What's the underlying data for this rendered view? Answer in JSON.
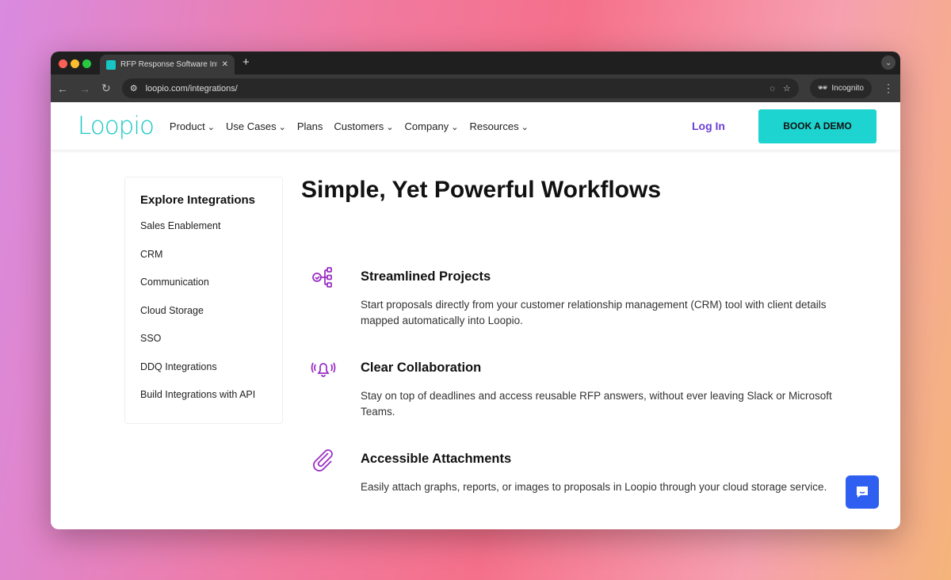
{
  "browser": {
    "tab_title": "RFP Response Software Integ",
    "url": "loopio.com/integrations/",
    "incognito": "Incognito"
  },
  "nav": {
    "logo": "Loopio",
    "items": [
      {
        "label": "Product",
        "dropdown": true
      },
      {
        "label": "Use Cases",
        "dropdown": true
      },
      {
        "label": "Plans",
        "dropdown": false
      },
      {
        "label": "Customers",
        "dropdown": true
      },
      {
        "label": "Company",
        "dropdown": true
      },
      {
        "label": "Resources",
        "dropdown": true
      }
    ],
    "login": "Log In",
    "demo": "BOOK A DEMO"
  },
  "sidebar": {
    "title": "Explore Integrations",
    "items": [
      "Sales Enablement",
      "CRM",
      "Communication",
      "Cloud Storage",
      "SSO",
      "DDQ Integrations",
      "Build Integrations with API"
    ]
  },
  "main": {
    "title": "Simple, Yet Powerful Workflows",
    "features": [
      {
        "icon": "workflow-icon",
        "title": "Streamlined Projects",
        "text": "Start proposals directly from your customer relationship management (CRM) tool with client details mapped automatically into Loopio."
      },
      {
        "icon": "bell-icon",
        "title": "Clear Collaboration",
        "text": "Stay on top of deadlines and access reusable RFP answers, without ever leaving Slack or Microsoft Teams."
      },
      {
        "icon": "paperclip-icon",
        "title": "Accessible Attachments",
        "text": "Easily attach graphs, reports, or images to proposals in Loopio through your cloud storage service."
      }
    ]
  },
  "colors": {
    "accent": "#1ed4d0",
    "login": "#6b3fd8",
    "icon": "#9b2fc4",
    "chat": "#2f5ff0"
  }
}
